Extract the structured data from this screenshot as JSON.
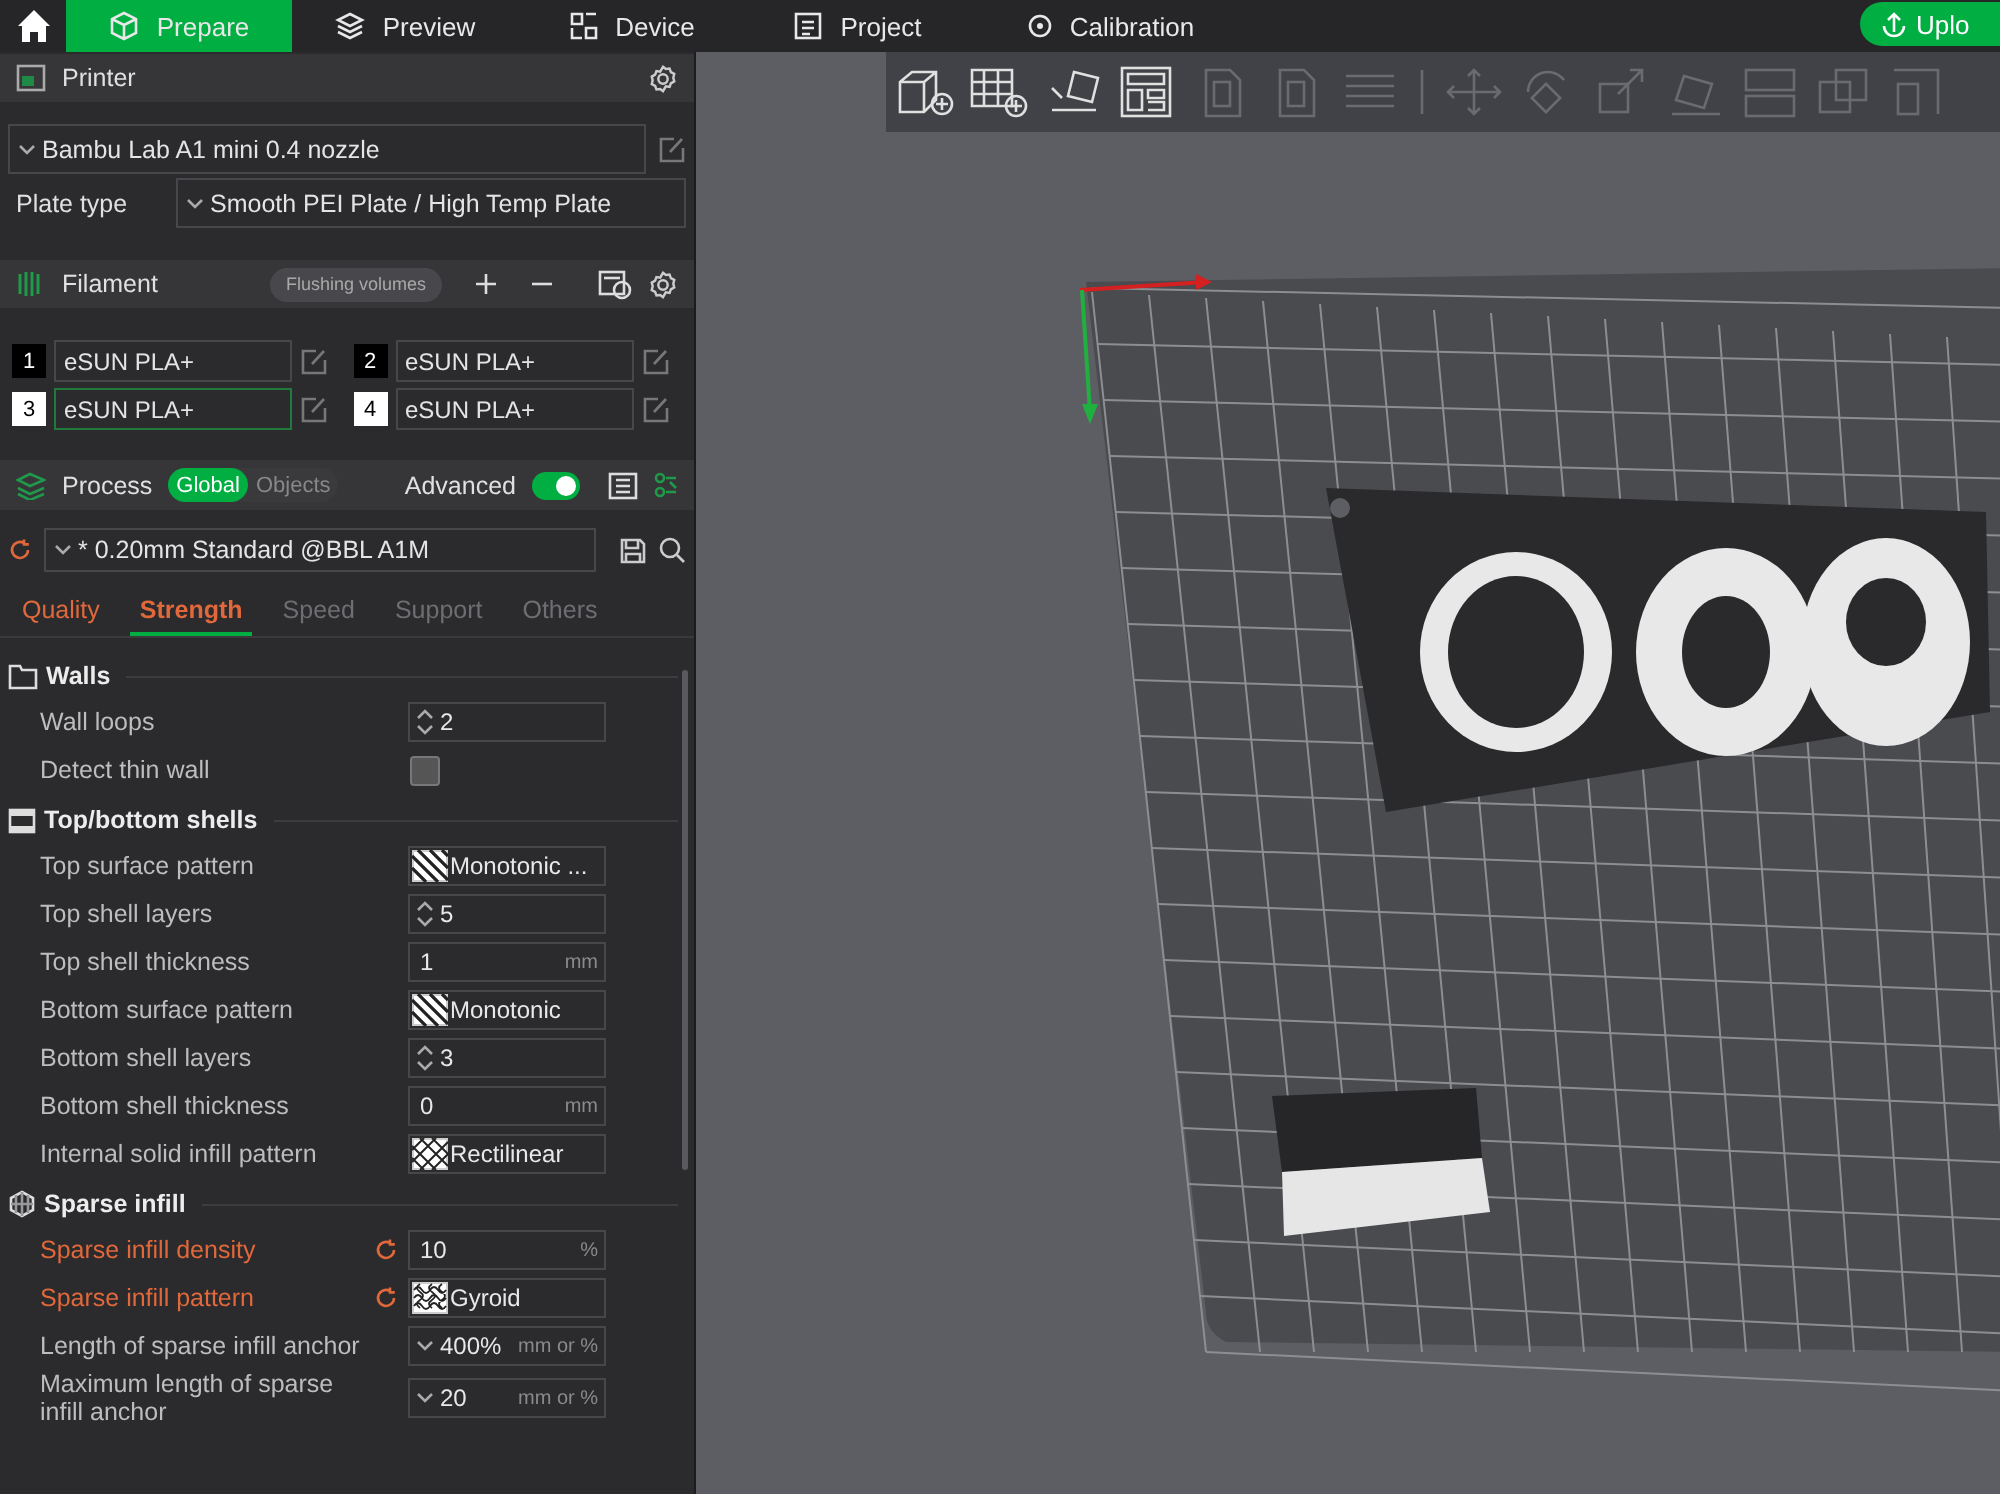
{
  "topbar": {
    "tabs": [
      {
        "label": "Prepare",
        "selected": true
      },
      {
        "label": "Preview",
        "selected": false
      },
      {
        "label": "Device",
        "selected": false
      },
      {
        "label": "Project",
        "selected": false
      },
      {
        "label": "Calibration",
        "selected": false
      }
    ],
    "upload_button": "Uplo"
  },
  "printer": {
    "title": "Printer",
    "preset": "Bambu Lab A1 mini 0.4 nozzle",
    "plate_type_label": "Plate type",
    "plate_type": "Smooth PEI Plate / High Temp Plate"
  },
  "filament": {
    "title": "Filament",
    "flushing_button": "Flushing volumes",
    "slots": [
      {
        "number": "1",
        "name": "eSUN PLA+",
        "color": "#000000",
        "selected": false
      },
      {
        "number": "2",
        "name": "eSUN PLA+",
        "color": "#000000",
        "selected": false
      },
      {
        "number": "3",
        "name": "eSUN PLA+",
        "color": "#ffffff",
        "selected": true
      },
      {
        "number": "4",
        "name": "eSUN PLA+",
        "color": "#ffffff",
        "selected": false
      }
    ]
  },
  "process": {
    "title": "Process",
    "modes": [
      {
        "label": "Global",
        "selected": true
      },
      {
        "label": "Objects",
        "selected": false
      }
    ],
    "advanced_label": "Advanced",
    "advanced_on": true,
    "preset": "* 0.20mm Standard @BBL A1M",
    "preset_modified": true,
    "tabs": [
      {
        "label": "Quality",
        "modified": true,
        "selected": false
      },
      {
        "label": "Strength",
        "modified": true,
        "selected": true
      },
      {
        "label": "Speed",
        "modified": false,
        "selected": false
      },
      {
        "label": "Support",
        "modified": false,
        "selected": false
      },
      {
        "label": "Others",
        "modified": false,
        "selected": false
      }
    ]
  },
  "groups": [
    {
      "title": "Walls",
      "rows": [
        {
          "label": "Wall loops",
          "kind": "spin",
          "value": "2",
          "modified": false
        },
        {
          "label": "Detect thin wall",
          "kind": "checkbox",
          "checked": false,
          "modified": false
        }
      ]
    },
    {
      "title": "Top/bottom shells",
      "rows": [
        {
          "label": "Top surface pattern",
          "kind": "hatch",
          "value": "Monotonic ...",
          "modified": false
        },
        {
          "label": "Top shell layers",
          "kind": "spin",
          "value": "5",
          "modified": false
        },
        {
          "label": "Top shell thickness",
          "kind": "number",
          "value": "1",
          "unit": "mm",
          "modified": false
        },
        {
          "label": "Bottom surface pattern",
          "kind": "hatch",
          "value": "Monotonic",
          "modified": false
        },
        {
          "label": "Bottom shell layers",
          "kind": "spin",
          "value": "3",
          "modified": false
        },
        {
          "label": "Bottom shell thickness",
          "kind": "number",
          "value": "0",
          "unit": "mm",
          "modified": false
        },
        {
          "label": "Internal solid infill pattern",
          "kind": "crosshatch",
          "value": "Rectilinear",
          "modified": false
        }
      ]
    },
    {
      "title": "Sparse infill",
      "rows": [
        {
          "label": "Sparse infill density",
          "kind": "number",
          "value": "10",
          "unit": "%",
          "modified": true
        },
        {
          "label": "Sparse infill pattern",
          "kind": "mesh",
          "value": "Gyroid",
          "modified": true
        },
        {
          "label": "Length of sparse infill anchor",
          "kind": "combo",
          "value": "400%",
          "unit": "mm or %",
          "modified": false
        },
        {
          "label": "Maximum length of sparse infill anchor",
          "kind": "combo",
          "value": "20",
          "unit": "mm or %",
          "modified": false
        }
      ]
    }
  ],
  "viewport_toolbar": [
    {
      "kind": "add-cube",
      "disabled": false
    },
    {
      "kind": "add-grid",
      "disabled": false
    },
    {
      "kind": "auto-orient",
      "disabled": false
    },
    {
      "kind": "layout",
      "disabled": false
    },
    {
      "kind": "page",
      "disabled": true
    },
    {
      "kind": "page",
      "disabled": true
    },
    {
      "kind": "lines",
      "disabled": true
    },
    {
      "kind": "separator",
      "disabled": true
    },
    {
      "kind": "move",
      "disabled": true
    },
    {
      "kind": "rotate",
      "disabled": true
    },
    {
      "kind": "scale",
      "disabled": true
    },
    {
      "kind": "lay",
      "disabled": true
    },
    {
      "kind": "split",
      "disabled": true
    },
    {
      "kind": "boolean",
      "disabled": true
    },
    {
      "kind": "paint",
      "disabled": true
    }
  ]
}
